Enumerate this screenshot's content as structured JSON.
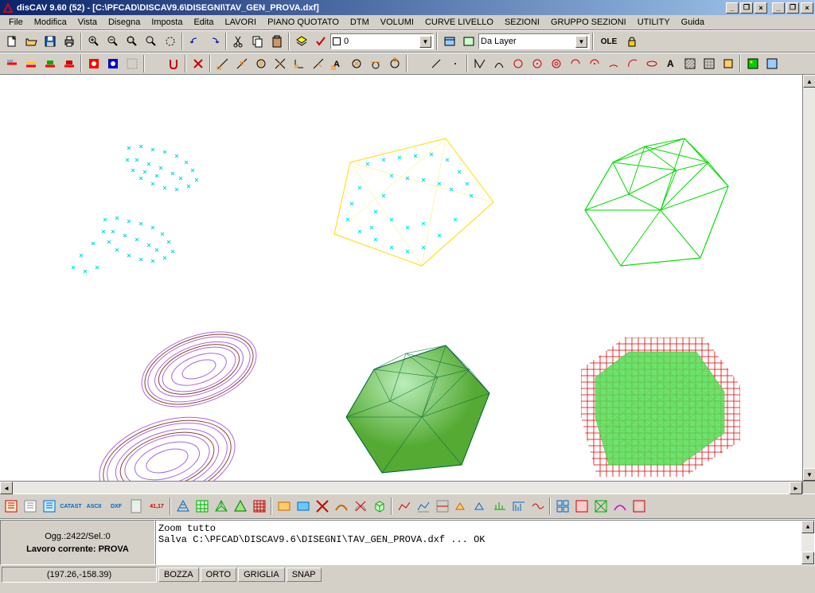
{
  "title": "disCAV 9.60 (52) - [C:\\PFCAD\\DISCAV9.6\\DISEGNI\\TAV_GEN_PROVA.dxf]",
  "menu": [
    "File",
    "Modifica",
    "Vista",
    "Disegna",
    "Imposta",
    "Edita",
    "LAVORI",
    "PIANO QUOTATO",
    "DTM",
    "VOLUMI",
    "CURVE LIVELLO",
    "SEZIONI",
    "GRUPPO SEZIONI",
    "UTILITY",
    "Guida"
  ],
  "toolbar1": {
    "layer_value": "0",
    "layer_dropdown": "Da Layer",
    "ole_label": "OLE"
  },
  "status": {
    "objects": "Ogg.:2422/Sel.:0",
    "lavoro": "Lavoro corrente: PROVA",
    "log1": "Zoom tutto",
    "log2": "Salva C:\\PFCAD\\DISCAV9.6\\DISEGNI\\TAV_GEN_PROVA.dxf ... OK",
    "coords": "(197.26,-158.39)"
  },
  "modes": [
    "BOZZA",
    "ORTO",
    "GRIGLIA",
    "SNAP"
  ]
}
